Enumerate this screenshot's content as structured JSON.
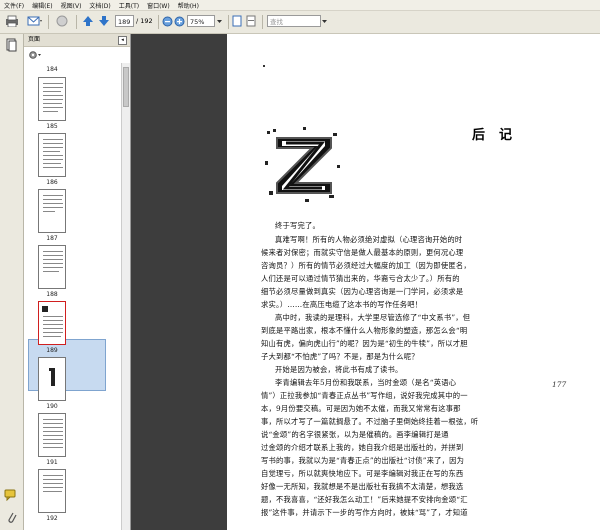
{
  "menu": {
    "items": [
      "文件(F)",
      "编辑(E)",
      "视图(V)",
      "文档(D)",
      "工具(T)",
      "窗口(W)",
      "帮助(H)"
    ]
  },
  "toolbar": {
    "page_current": "189",
    "page_total": "/ 192",
    "zoom": "75%",
    "search_placeholder": "查找"
  },
  "sidebar": {
    "panel_title": "页面",
    "pages": [
      {
        "label": "184"
      },
      {
        "label": "185"
      },
      {
        "label": "186"
      },
      {
        "label": "187"
      },
      {
        "label": "188"
      },
      {
        "label": "189"
      },
      {
        "label": "190"
      },
      {
        "label": "191"
      },
      {
        "label": "192"
      }
    ]
  },
  "document": {
    "title": "后记",
    "drop_letter": "Z",
    "page_number": "177",
    "lines": [
      "终于写完了。",
      "真难写啊！所有的人物必须绝对虚拟（心理咨询开始的时",
      "候来者对保密；而就实守信是做人最基本的原则，更何况心理",
      "咨询员？）所有的情节必须经过大幅度的加工（因为即使匿名，",
      "人们还是可以通过情节猜出来的，华裔亏合太少了。）所有的",
      "细节必须尽量做到真实（因为心理咨询是一门学问，必须求是",
      "求实。）……在高压电缆了这本书的写作任务吧！",
      "高中时，我读的是理科，大学里尽管选修了“中文系书”，但",
      "到底是平路出家，根本不懂什么人物形象的塑造，那怎么会“明",
      "知山有虎，偏向虎山行”的呢？因为是“初生的牛犊”，所以才胆",
      "子大到都“不怕虎”了吗？不是，那是为什么呢？",
      "开始是因为被会，将此书有成了读书。",
      "李青编辑去年5月份和我联系，当时金颂（是名“英语心",
      "情”）正拉我参加“青春正点丛书”写作组，说好我完成其中的一",
      "本，9月份要交稿。可是因为她不太催，而我又常常有这事那",
      "事，所以才写了一篇就搁悬了。不过脑子里倒始终挂着一根弦，听",
      "说“金颂”的名字很紧张，以为是催稿的。画李编辑打是通",
      "过金颂的介绍才联系上我的，她自我介绍是出版社的，并拼到",
      "写书的事，我就以为是“青春正点”的出版社“讨债”来了，因为",
      "自觉理亏，所以就爽快地应下。可是李编辑对我正在写的东西",
      "好像一无所知，我就想是不是出版社有我搞不太清楚，想我选",
      "题，不我喜喜，“还好我怎么动工！”后来她提不安排向金颂“汇",
      "报”这件事，并请示下一步的写作方向时，被妹“骂”了，才知道"
    ]
  }
}
